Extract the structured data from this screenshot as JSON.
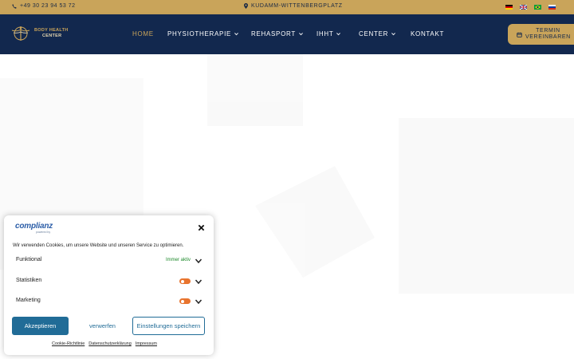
{
  "topbar": {
    "phone": "+49 30 23 94 53 72",
    "location": "KUDAMM-WITTENBERGPLATZ",
    "languages": [
      {
        "name": "Deutsch",
        "icon": "flag-de-icon"
      },
      {
        "name": "English",
        "icon": "flag-uk-icon"
      },
      {
        "name": "Português",
        "icon": "flag-br-icon"
      },
      {
        "name": "Русский",
        "icon": "flag-ru-icon"
      }
    ]
  },
  "logo": {
    "line1": "BODY HEALTH",
    "line2": "CENTER"
  },
  "menu": [
    {
      "label": "HOME",
      "active": true,
      "dropdown": false
    },
    {
      "label": "PHYSIOTHERAPIE",
      "active": false,
      "dropdown": true
    },
    {
      "label": "REHASPORT",
      "active": false,
      "dropdown": true
    },
    {
      "label": "IHHT",
      "active": false,
      "dropdown": true
    },
    {
      "label": "CENTER",
      "active": false,
      "dropdown": true
    },
    {
      "label": "KONTAKT",
      "active": false,
      "dropdown": false
    }
  ],
  "cta": {
    "line1": "TERMIN",
    "line2": "VEREINBAREN"
  },
  "consent": {
    "brand": "complianz",
    "brand_sub": "powered by",
    "intro": "Wir verwenden Cookies, um unsere Website und unseren Service zu optimieren.",
    "categories": [
      {
        "label": "Funktional",
        "status": "Immer aktiv"
      },
      {
        "label": "Statistiken",
        "status": ""
      },
      {
        "label": "Marketing",
        "status": ""
      }
    ],
    "accept": "Akzeptieren",
    "deny": "verwerfen",
    "settings": "Einstellungen speichern",
    "links": [
      "Cookie-Richtlinie",
      "Datenschutzerklärung",
      "Impressum"
    ]
  },
  "colors": {
    "gold": "#c9a45a",
    "navy": "#12284e",
    "consent_blue": "#216c97",
    "toggle_orange": "#e8742e",
    "active_green": "#1e8a2c"
  }
}
